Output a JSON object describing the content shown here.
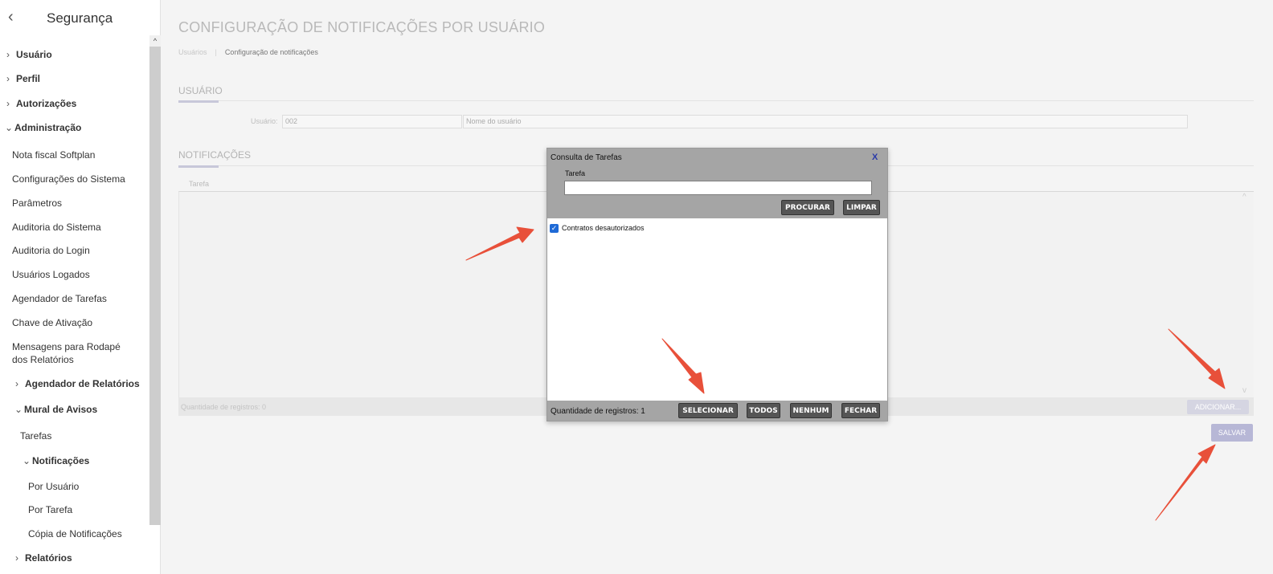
{
  "sidebar": {
    "title": "Segurança",
    "items": [
      {
        "label": "Usuário",
        "chevron": "›"
      },
      {
        "label": "Perfil",
        "chevron": "›"
      },
      {
        "label": "Autorizações",
        "chevron": "›"
      },
      {
        "label": "Administração",
        "chevron": "⌄"
      },
      {
        "label": "Nota fiscal Softplan"
      },
      {
        "label": "Configurações do Sistema"
      },
      {
        "label": "Parâmetros"
      },
      {
        "label": "Auditoria do Sistema"
      },
      {
        "label": "Auditoria do Login"
      },
      {
        "label": "Usuários Logados"
      },
      {
        "label": "Agendador de Tarefas"
      },
      {
        "label": "Chave de Ativação"
      },
      {
        "label": "Mensagens para Rodapé"
      },
      {
        "label": "dos Relatórios"
      },
      {
        "label": "Agendador de Relatórios",
        "chevron": "›"
      },
      {
        "label": "Mural de Avisos",
        "chevron": "⌄"
      },
      {
        "label": "Tarefas"
      },
      {
        "label": "Notificações",
        "chevron": "⌄"
      },
      {
        "label": "Por Usuário"
      },
      {
        "label": "Por Tarefa"
      },
      {
        "label": "Cópia de Notificações"
      },
      {
        "label": "Relatórios",
        "chevron": "›"
      }
    ]
  },
  "main": {
    "title": "CONFIGURAÇÃO DE NOTIFICAÇÕES POR USUÁRIO",
    "breadcrumb": [
      "Usuários",
      "Configuração de notificações"
    ],
    "usuario_section": {
      "label": "USUÁRIO",
      "field_label": "Usuário:",
      "code_value": "002",
      "name_placeholder": "Nome do usuário"
    },
    "notificacoes_section": {
      "label": "NOTIFICAÇÕES",
      "column_header": "Tarefa",
      "record_count": "Quantidade de registros: 0",
      "add_button": "ADICIONAR...",
      "save_button": "SALVAR"
    }
  },
  "modal": {
    "title": "Consulta de Tarefas",
    "close": "X",
    "search_label": "Tarefa",
    "search_value": "",
    "search_button": "PROCURAR",
    "clear_button": "LIMPAR",
    "items": [
      {
        "label": "Contratos desautorizados",
        "checked": true
      }
    ],
    "record_count": "Quantidade de registros: 1",
    "select_button": "SELECIONAR",
    "all_button": "TODOS",
    "none_button": "NENHUM",
    "close_button": "FECHAR"
  },
  "colors": {
    "annotation_arrow": "#e8503a",
    "modal_chrome": "#a5a5a5",
    "primary_disabled": "#b7b7d6",
    "checkbox": "#1f6ad6"
  }
}
